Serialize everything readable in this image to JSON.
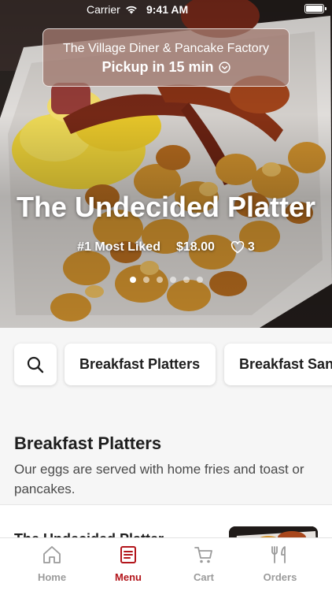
{
  "status_bar": {
    "carrier": "Carrier",
    "time": "9:41 AM"
  },
  "pickup": {
    "restaurant": "The Village Diner & Pancake Factory",
    "label": "Pickup in 15 min"
  },
  "hero": {
    "title": "The Undecided Platter",
    "rank": "#1 Most Liked",
    "price": "$18.00",
    "likes": "3",
    "slide_count": 6,
    "active_slide": 1
  },
  "categories": [
    "Breakfast Platters",
    "Breakfast San"
  ],
  "section": {
    "title": "Breakfast Platters",
    "description": "Our eggs are served with home fries and toast or pancakes."
  },
  "items": [
    {
      "name": "The Undecided Platter"
    }
  ],
  "tabs": [
    {
      "label": "Home",
      "icon": "home-icon"
    },
    {
      "label": "Menu",
      "icon": "menu-icon"
    },
    {
      "label": "Cart",
      "icon": "cart-icon"
    },
    {
      "label": "Orders",
      "icon": "orders-icon"
    }
  ],
  "colors": {
    "accent": "#b3151b",
    "inactive": "#9b9b9b",
    "background": "#f6f6f6"
  }
}
